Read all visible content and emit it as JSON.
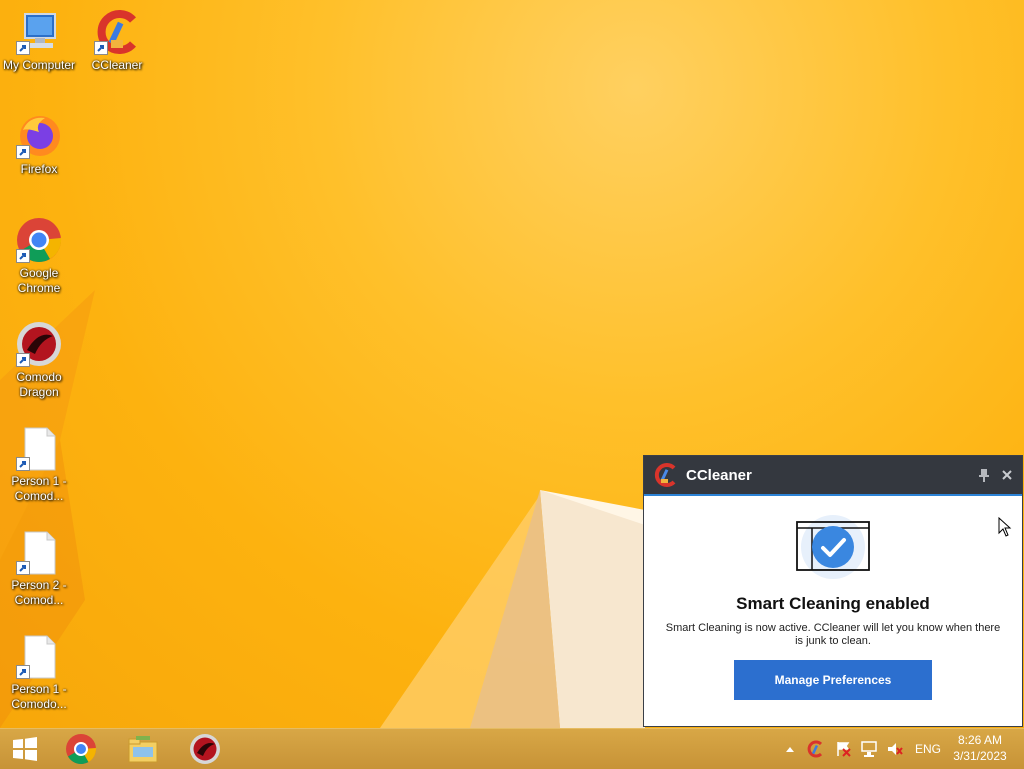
{
  "desktop": {
    "icons": [
      {
        "label": "My Computer",
        "icon": "computer-icon"
      },
      {
        "label": "CCleaner",
        "icon": "ccleaner-icon"
      },
      {
        "label": "Firefox",
        "icon": "firefox-icon"
      },
      {
        "label": "Google Chrome",
        "icon": "chrome-icon"
      },
      {
        "label": "Comodo Dragon",
        "icon": "comodo-dragon-icon"
      },
      {
        "label": "Person 1 - Comod...",
        "icon": "document-icon"
      },
      {
        "label": "Person 2 - Comod...",
        "icon": "document-icon"
      },
      {
        "label": "Person 1 - Comodo...",
        "icon": "document-icon"
      }
    ]
  },
  "notification": {
    "app_name": "CCleaner",
    "heading": "Smart Cleaning enabled",
    "message": "Smart Cleaning is now active. CCleaner will let you know when there is junk to clean.",
    "button_label": "Manage Preferences",
    "accent_color": "#2c6fcf"
  },
  "taskbar": {
    "pinned": [
      "start-icon",
      "chrome-icon",
      "file-explorer-icon",
      "comodo-dragon-icon"
    ],
    "tray_icons": [
      "show-hidden-icons-icon",
      "ccleaner-icon",
      "action-center-icon",
      "network-icon",
      "volume-muted-icon"
    ],
    "language": "ENG",
    "time": "8:26 AM",
    "date": "3/31/2023"
  }
}
